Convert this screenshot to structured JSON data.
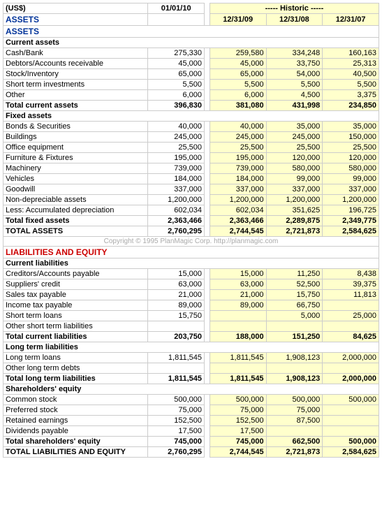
{
  "table": {
    "currency": "(US$)",
    "historic_label": "----- Historic -----",
    "columns": {
      "label": "",
      "current": "01/01/10",
      "h1": "12/31/09",
      "h2": "12/31/08",
      "h3": "12/31/07"
    },
    "assets_title": "ASSETS",
    "liabilities_title": "LIABILITIES AND EQUITY",
    "copyright": "Copyright © 1995 PlanMagic Corp. http://planmagic.com",
    "sections": [
      {
        "id": "current_assets",
        "header": "Current assets",
        "rows": [
          {
            "label": "Cash/Bank",
            "cur": "275,330",
            "h1": "259,580",
            "h2": "334,248",
            "h3": "160,163"
          },
          {
            "label": "Debtors/Accounts receivable",
            "cur": "45,000",
            "h1": "45,000",
            "h2": "33,750",
            "h3": "25,313"
          },
          {
            "label": "Stock/Inventory",
            "cur": "65,000",
            "h1": "65,000",
            "h2": "54,000",
            "h3": "40,500"
          },
          {
            "label": "Short term investments",
            "cur": "5,500",
            "h1": "5,500",
            "h2": "5,500",
            "h3": "5,500"
          },
          {
            "label": "Other",
            "cur": "6,000",
            "h1": "6,000",
            "h2": "4,500",
            "h3": "3,375"
          }
        ],
        "total": {
          "label": "Total current assets",
          "cur": "396,830",
          "h1": "381,080",
          "h2": "431,998",
          "h3": "234,850"
        }
      },
      {
        "id": "fixed_assets",
        "header": "Fixed assets",
        "rows": [
          {
            "label": "Bonds & Securities",
            "cur": "40,000",
            "h1": "40,000",
            "h2": "35,000",
            "h3": "35,000"
          },
          {
            "label": "Buildings",
            "cur": "245,000",
            "h1": "245,000",
            "h2": "245,000",
            "h3": "150,000"
          },
          {
            "label": "Office equipment",
            "cur": "25,500",
            "h1": "25,500",
            "h2": "25,500",
            "h3": "25,500"
          },
          {
            "label": "Furniture & Fixtures",
            "cur": "195,000",
            "h1": "195,000",
            "h2": "120,000",
            "h3": "120,000"
          },
          {
            "label": "Machinery",
            "cur": "739,000",
            "h1": "739,000",
            "h2": "580,000",
            "h3": "580,000"
          },
          {
            "label": "Vehicles",
            "cur": "184,000",
            "h1": "184,000",
            "h2": "99,000",
            "h3": "99,000"
          },
          {
            "label": "Goodwill",
            "cur": "337,000",
            "h1": "337,000",
            "h2": "337,000",
            "h3": "337,000"
          },
          {
            "label": "Non-depreciable assets",
            "cur": "1,200,000",
            "h1": "1,200,000",
            "h2": "1,200,000",
            "h3": "1,200,000"
          },
          {
            "label": "Less: Accumulated depreciation",
            "cur": "602,034",
            "h1": "602,034",
            "h2": "351,625",
            "h3": "196,725"
          }
        ],
        "total": {
          "label": "Total fixed assets",
          "cur": "2,363,466",
          "h1": "2,363,466",
          "h2": "2,289,875",
          "h3": "2,349,775"
        }
      }
    ],
    "total_assets": {
      "label": "TOTAL ASSETS",
      "cur": "2,760,295",
      "h1": "2,744,545",
      "h2": "2,721,873",
      "h3": "2,584,625"
    },
    "liabilities_sections": [
      {
        "id": "current_liabilities",
        "header": "Current liabilities",
        "rows": [
          {
            "label": "Creditors/Accounts payable",
            "cur": "15,000",
            "h1": "15,000",
            "h2": "11,250",
            "h3": "8,438"
          },
          {
            "label": "Suppliers' credit",
            "cur": "63,000",
            "h1": "63,000",
            "h2": "52,500",
            "h3": "39,375"
          },
          {
            "label": "Sales tax payable",
            "cur": "21,000",
            "h1": "21,000",
            "h2": "15,750",
            "h3": "11,813"
          },
          {
            "label": "Income tax payable",
            "cur": "89,000",
            "h1": "89,000",
            "h2": "66,750",
            "h3": ""
          },
          {
            "label": "Short term loans",
            "cur": "15,750",
            "h1": "",
            "h2": "5,000",
            "h3": "25,000"
          },
          {
            "label": "Other short term liabilities",
            "cur": "",
            "h1": "",
            "h2": "",
            "h3": ""
          }
        ],
        "total": {
          "label": "Total current liabilities",
          "cur": "203,750",
          "h1": "188,000",
          "h2": "151,250",
          "h3": "84,625"
        }
      },
      {
        "id": "long_term_liabilities",
        "header": "Long term liabilities",
        "rows": [
          {
            "label": "Long term loans",
            "cur": "1,811,545",
            "h1": "1,811,545",
            "h2": "1,908,123",
            "h3": "2,000,000"
          },
          {
            "label": "Other long term debts",
            "cur": "",
            "h1": "",
            "h2": "",
            "h3": ""
          }
        ],
        "total": {
          "label": "Total long term liabilities",
          "cur": "1,811,545",
          "h1": "1,811,545",
          "h2": "1,908,123",
          "h3": "2,000,000"
        }
      },
      {
        "id": "shareholders_equity",
        "header": "Shareholders' equity",
        "rows": [
          {
            "label": "Common stock",
            "cur": "500,000",
            "h1": "500,000",
            "h2": "500,000",
            "h3": "500,000"
          },
          {
            "label": "Preferred stock",
            "cur": "75,000",
            "h1": "75,000",
            "h2": "75,000",
            "h3": ""
          },
          {
            "label": "Retained earnings",
            "cur": "152,500",
            "h1": "152,500",
            "h2": "87,500",
            "h3": ""
          },
          {
            "label": "Dividends payable",
            "cur": "17,500",
            "h1": "17,500",
            "h2": "",
            "h3": ""
          }
        ],
        "total": {
          "label": "Total shareholders' equity",
          "cur": "745,000",
          "h1": "745,000",
          "h2": "662,500",
          "h3": "500,000"
        }
      }
    ],
    "total_liabilities": {
      "label": "TOTAL LIABILITIES AND EQUITY",
      "cur": "2,760,295",
      "h1": "2,744,545",
      "h2": "2,721,873",
      "h3": "2,584,625"
    }
  }
}
